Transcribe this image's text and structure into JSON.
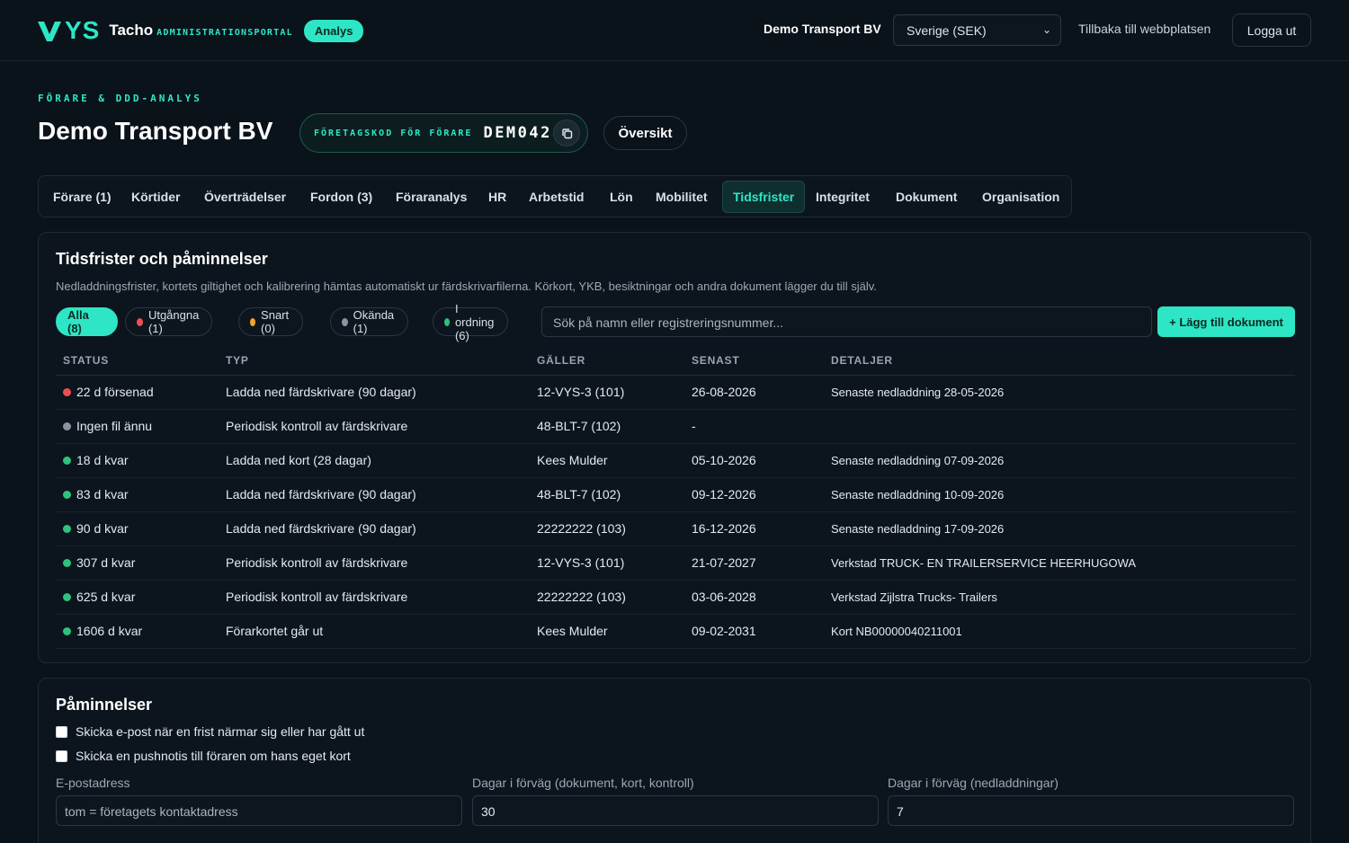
{
  "header": {
    "logo_text": "YS",
    "app_name": "Tacho",
    "app_subtitle": "ADMINISTRATIONSPORTAL",
    "badge": "Analys",
    "company": "Demo Transport BV",
    "country_select": "Sverige (SEK)",
    "back_link": "Tillbaka till webbplatsen",
    "logout": "Logga ut"
  },
  "page": {
    "eyebrow": "FÖRARE & DDD-ANALYS",
    "title": "Demo Transport BV",
    "code_label": "FÖRETAGSKOD FÖR FÖRARE",
    "code_value": "DEM042",
    "overview_button": "Översikt"
  },
  "tabs": [
    {
      "label": "Förare (1)"
    },
    {
      "label": "Körtider"
    },
    {
      "label": "Överträdelser"
    },
    {
      "label": "Fordon (3)"
    },
    {
      "label": "Föraranalys"
    },
    {
      "label": "HR"
    },
    {
      "label": "Arbetstid"
    },
    {
      "label": "Lön"
    },
    {
      "label": "Mobilitet"
    },
    {
      "label": "Tidsfrister",
      "active": true
    },
    {
      "label": "Integritet"
    },
    {
      "label": "Dokument"
    },
    {
      "label": "Organisation"
    }
  ],
  "deadlines": {
    "title": "Tidsfrister och påminnelser",
    "subtitle": "Nedladdningsfrister, kortets giltighet och kalibrering hämtas automatiskt ur färdskrivarfilerna. Körkort, YKB, besiktningar och andra dokument lägger du till själv.",
    "filters": [
      {
        "label": "Alla (8)",
        "active": true,
        "dot_color": ""
      },
      {
        "label": "Utgångna (1)",
        "dot_color": "#f04e4e"
      },
      {
        "label": "Snart (0)",
        "dot_color": "#f5a524"
      },
      {
        "label": "Okända (1)",
        "dot_color": "#8894a0"
      },
      {
        "label": "I ordning (6)",
        "dot_color": "#2ec27e"
      }
    ],
    "search_placeholder": "Sök på namn eller registreringsnummer...",
    "add_button": "+ Lägg till dokument",
    "columns": [
      "STATUS",
      "TYP",
      "GÄLLER",
      "SENAST",
      "DETALJER"
    ],
    "rows": [
      {
        "status": "22 d försenad",
        "status_color": "#f04e4e",
        "type": "Ladda ned färdskrivare (90 dagar)",
        "applies": "12-VYS-3 (101)",
        "latest": "26-08-2026",
        "details": "Senaste nedladdning 28-05-2026"
      },
      {
        "status": "Ingen fil ännu",
        "status_color": "#8894a0",
        "type": "Periodisk kontroll av färdskrivare",
        "applies": "48-BLT-7 (102)",
        "latest": "-",
        "details": ""
      },
      {
        "status": "18 d kvar",
        "status_color": "#2ec27e",
        "type": "Ladda ned kort (28 dagar)",
        "applies": "Kees Mulder",
        "latest": "05-10-2026",
        "details": "Senaste nedladdning 07-09-2026"
      },
      {
        "status": "83 d kvar",
        "status_color": "#2ec27e",
        "type": "Ladda ned färdskrivare (90 dagar)",
        "applies": "48-BLT-7 (102)",
        "latest": "09-12-2026",
        "details": "Senaste nedladdning 10-09-2026"
      },
      {
        "status": "90 d kvar",
        "status_color": "#2ec27e",
        "type": "Ladda ned färdskrivare (90 dagar)",
        "applies": "22222222 (103)",
        "latest": "16-12-2026",
        "details": "Senaste nedladdning 17-09-2026"
      },
      {
        "status": "307 d kvar",
        "status_color": "#2ec27e",
        "type": "Periodisk kontroll av färdskrivare",
        "applies": "12-VYS-3 (101)",
        "latest": "21-07-2027",
        "details": "Verkstad TRUCK- EN TRAILERSERVICE HEERHUGOWA"
      },
      {
        "status": "625 d kvar",
        "status_color": "#2ec27e",
        "type": "Periodisk kontroll av färdskrivare",
        "applies": "22222222 (103)",
        "latest": "03-06-2028",
        "details": "Verkstad Zijlstra Trucks- Trailers"
      },
      {
        "status": "1606 d kvar",
        "status_color": "#2ec27e",
        "type": "Förarkortet går ut",
        "applies": "Kees Mulder",
        "latest": "09-02-2031",
        "details": "Kort NB00000040211001"
      }
    ]
  },
  "reminders": {
    "title": "Påminnelser",
    "email_checkbox": "Skicka e-post när en frist närmar sig eller har gått ut",
    "push_checkbox": "Skicka en pushnotis till föraren om hans eget kort",
    "email_label": "E-postadress",
    "email_placeholder": "tom = företagets kontaktadress",
    "days_docs_label": "Dagar i förväg (dokument, kort, kontroll)",
    "days_docs_value": "30",
    "days_downloads_label": "Dagar i förväg (nedladdningar)",
    "days_downloads_value": "7"
  },
  "colors": {
    "accent": "#2ee6c5",
    "background": "#0a121a",
    "overdue": "#f04e4e",
    "soon": "#f5a524",
    "unknown": "#8894a0",
    "ok": "#2ec27e"
  }
}
